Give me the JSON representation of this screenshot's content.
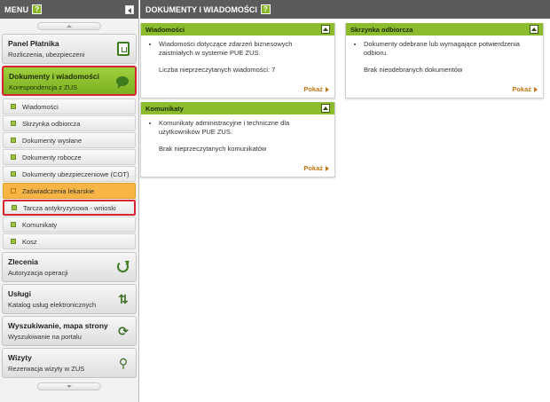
{
  "sidebar": {
    "title": "MENU",
    "help": "?",
    "sections_top": [
      {
        "title": "Panel Płatnika",
        "subtitle": "Rozliczenia, ubezpieczeni",
        "icon": "panel-icon"
      },
      {
        "title": "Dokumenty i wiadomości",
        "subtitle": "Korespondencja z ZUS",
        "icon": "speech-bubble-icon",
        "active": true
      }
    ],
    "sub_items": [
      {
        "label": "Wiadomości"
      },
      {
        "label": "Skrzynka odbiorcza"
      },
      {
        "label": "Dokumenty wysłane"
      },
      {
        "label": "Dokumenty robocze"
      },
      {
        "label": "Dokumenty ubezpieczeniowe (COT)"
      },
      {
        "label": "Zaświadczenia lekarskie"
      },
      {
        "label": "Tarcza antykryzysowa - wnioski"
      },
      {
        "label": "Komunikaty"
      },
      {
        "label": "Kosz"
      }
    ],
    "sections_bottom": [
      {
        "title": "Zlecenia",
        "subtitle": "Autoryzacja operacji",
        "icon": "refresh-icon"
      },
      {
        "title": "Usługi",
        "subtitle": "Katalog usług elektronicznych",
        "icon": "services-icon"
      },
      {
        "title": "Wyszukiwanie, mapa strony",
        "subtitle": "Wyszukiwanie na portalu",
        "icon": "sync-icon"
      },
      {
        "title": "Wizyty",
        "subtitle": "Rezerwacja wizyty w ZUS",
        "icon": "walking-person-icon"
      }
    ]
  },
  "main": {
    "title": "DOKUMENTY I WIADOMOŚCI",
    "help": "?",
    "widgets": {
      "wiadomosci": {
        "title": "Wiadomości",
        "bullet": "Wiadomości dotyczące zdarzeń biznesowych zaistniałych w systemie PUE ZUS.",
        "extra": "Liczba nieprzeczytanych wiadomości: 7",
        "link": "Pokaż"
      },
      "skrzynka": {
        "title": "Skrzynka odbiorcza",
        "bullet": "Dokumenty odebrane lub wymagające potwierdzenia odbioru.",
        "extra": "Brak nieodebranych dokumentów",
        "link": "Pokaż"
      },
      "komunikaty": {
        "title": "Komunikaty",
        "bullet": "Komunikaty administracyjne i techniczne dla użytkowników PUE ZUS.",
        "extra": "Brak nieprzeczytanych komunikatów",
        "link": "Pokaż"
      }
    }
  },
  "colors": {
    "accent_green": "#8cbb2e",
    "active_green": "#9fd03d",
    "highlight_red": "#d7262f",
    "orange_item": "#f6b545",
    "header_gray": "#5b5b5b",
    "link_orange": "#c0771a"
  }
}
